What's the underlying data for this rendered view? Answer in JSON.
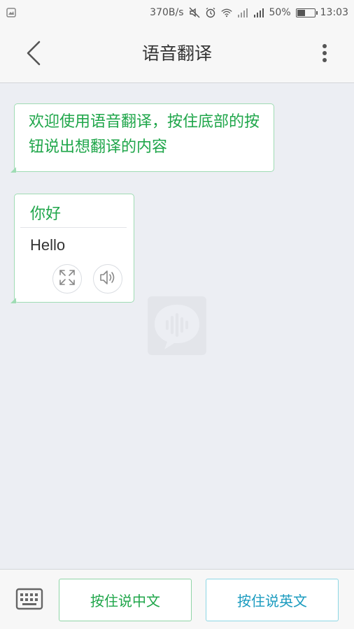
{
  "status_bar": {
    "net_speed": "370B/s",
    "battery": "50%",
    "battery_level": 0.5,
    "time": "13:03",
    "icons": [
      "notification-image-icon",
      "mute-icon",
      "alarm-icon",
      "wifi-icon",
      "signal-icon",
      "signal-icon",
      "battery-icon"
    ]
  },
  "header": {
    "title": "语音翻译",
    "back_icon": "chevron-left-icon",
    "more_icon": "more-vertical-icon"
  },
  "chat": {
    "welcome": "欢迎使用语音翻译，按住底部的按钮说出想翻译的内容",
    "translation": {
      "source": "你好",
      "target": "Hello",
      "expand_icon": "expand-icon",
      "speaker_icon": "speaker-icon"
    },
    "watermark_icon": "voice-chat-icon"
  },
  "bottom_bar": {
    "keyboard_icon": "keyboard-icon",
    "talk_chinese": "按住说中文",
    "talk_english": "按住说英文"
  },
  "colors": {
    "green": "#1fa64a",
    "blue": "#1a9bbf",
    "background": "#eceef3"
  }
}
